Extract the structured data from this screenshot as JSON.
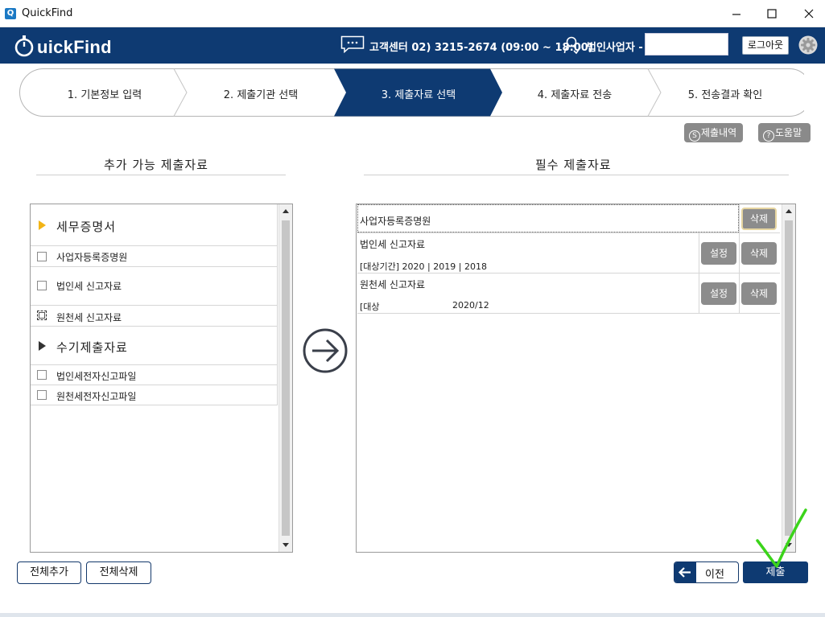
{
  "window": {
    "title": "QuickFind"
  },
  "header": {
    "logo_text": "uickFind",
    "customer_center": "고객센터 02) 3215-2674 (09:00 ~ 18:00)",
    "user_label": "법인사업자 -",
    "user_value": "",
    "logout_label": "로그아웃"
  },
  "steps": [
    {
      "label": "1. 기본정보 입력"
    },
    {
      "label": "2. 제출기관 선택"
    },
    {
      "label": "3. 제출자료 선택"
    },
    {
      "label": "4. 제출자료 전송"
    },
    {
      "label": "5. 전송결과 확인"
    }
  ],
  "toolbar": {
    "history_label": "제출내역",
    "help_label": "도움말"
  },
  "left": {
    "title": "추가 가능 제출자료",
    "category1": "세무증명서",
    "items1": [
      "사업자등록증명원",
      "법인세 신고자료",
      "원천세 신고자료"
    ],
    "category2": "수기제출자료",
    "items2": [
      "법인세전자신고파일",
      "원천세전자신고파일"
    ]
  },
  "right": {
    "title": "필수 제출자료",
    "rows": [
      {
        "name": "사업자등록증명원",
        "period": "",
        "delete_label": "삭제"
      },
      {
        "name": "법인세 신고자료",
        "period": "[대상기간] 2020 | 2019 | 2018",
        "setting_label": "설정",
        "delete_label": "삭제"
      },
      {
        "name": "원천세 신고자료",
        "period_prefix": "[대상",
        "period_value": "2020/12",
        "setting_label": "설정",
        "delete_label": "삭제"
      }
    ]
  },
  "bottom": {
    "add_all_label": "전체추가",
    "delete_all_label": "전체삭제",
    "prev_label": "이전",
    "submit_label": "제출"
  },
  "colors": {
    "brand": "#0e3a72",
    "button_gray": "#8c8c8c",
    "category_arrow_active": "#f2b416",
    "annotation_check": "#3bd41a"
  }
}
